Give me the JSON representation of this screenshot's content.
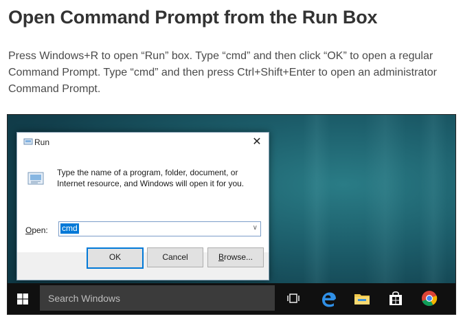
{
  "article": {
    "heading": "Open Command Prompt from the Run Box",
    "paragraph_lines": [
      "Press Windows+R to open “Run” box. Type “cmd” and then click “OK” to open a regular",
      "Command Prompt. Type “cmd” and then press Ctrl+Shift+Enter to open an administrator",
      "Command Prompt."
    ]
  },
  "run_dialog": {
    "title": "Run",
    "close_glyph": "✕",
    "description_lines": [
      "Type the name of a program, folder, document, or",
      "Internet resource, and Windows will open it for you."
    ],
    "open_label_mnemonic": "O",
    "open_label_rest": "pen:",
    "open_value": "cmd",
    "dropdown_glyph": "∨",
    "ok_label": "OK",
    "cancel_label": "Cancel",
    "browse_label_mnemonic": "B",
    "browse_label_rest": "rowse..."
  },
  "taskbar": {
    "search_placeholder": "Search Windows",
    "icons": [
      "windows-start-icon",
      "task-view-icon",
      "edge-icon",
      "file-explorer-icon",
      "store-icon",
      "chrome-icon"
    ]
  },
  "colors": {
    "accent": "#0078d7",
    "heading_text": "#333333",
    "taskbar": "#101010"
  }
}
